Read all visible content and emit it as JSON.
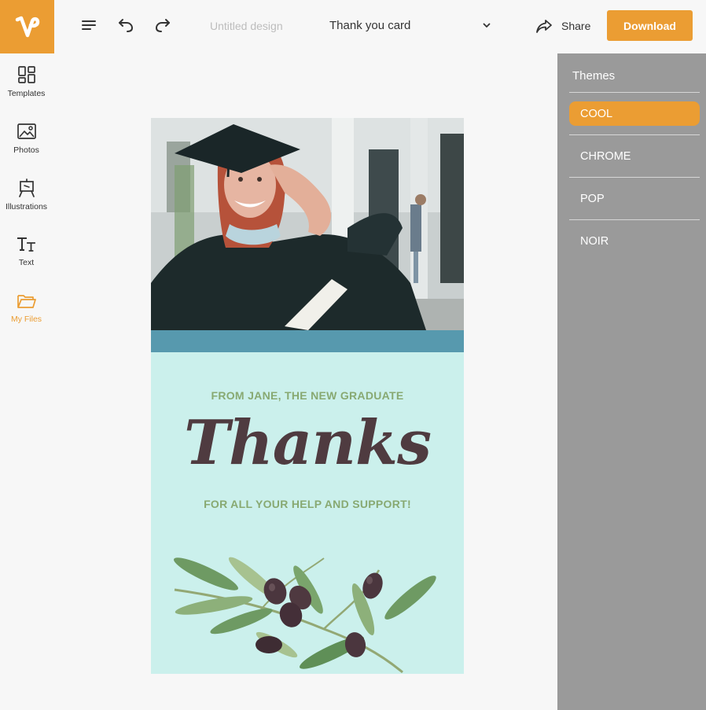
{
  "toolbar": {
    "doc_name": "Untitled design",
    "template_name": "Thank you card",
    "share_label": "Share",
    "download_label": "Download"
  },
  "sidebar": {
    "items": [
      {
        "label": "Templates",
        "icon": "templates-icon"
      },
      {
        "label": "Photos",
        "icon": "photos-icon"
      },
      {
        "label": "Illustrations",
        "icon": "illustrations-icon"
      },
      {
        "label": "Text",
        "icon": "text-icon"
      },
      {
        "label": "My Files",
        "icon": "folder-icon",
        "active": true
      }
    ]
  },
  "card": {
    "from_line": "FROM JANE, THE NEW GRADUATE",
    "headline": "Thanks",
    "support_line": "FOR ALL YOUR HELP AND SUPPORT!"
  },
  "themes": {
    "title": "Themes",
    "options": [
      "COOL",
      "CHROME",
      "POP",
      "NOIR"
    ],
    "selected": "COOL"
  },
  "colors": {
    "accent": "#eb9d33",
    "panel": "#9a9a9a",
    "card_band": "#5799ae",
    "card_bg": "#cbf0ec",
    "card_subtext": "#88a972",
    "card_headline": "#4f3b40"
  }
}
